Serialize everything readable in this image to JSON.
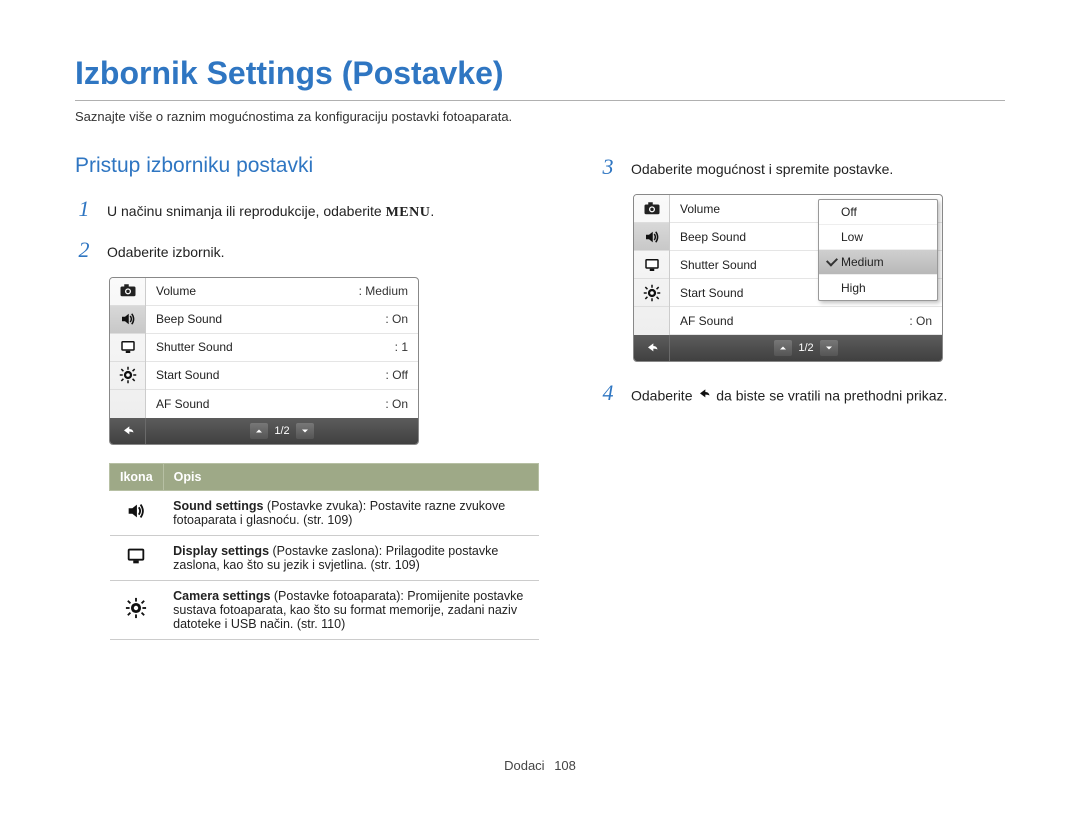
{
  "title": "Izbornik Settings (Postavke)",
  "subtitle": "Saznajte više o raznim mogućnostima za konfiguraciju postavki fotoaparata.",
  "sectionHeading": "Pristup izborniku postavki",
  "menuGlyph": "MENU",
  "steps": {
    "s1": {
      "num": "1",
      "text_a": "U načinu snimanja ili reprodukcije, odaberite ",
      "text_b": "."
    },
    "s2": {
      "num": "2",
      "text": "Odaberite izbornik."
    },
    "s3": {
      "num": "3",
      "text": "Odaberite mogućnost i spremite postavke."
    },
    "s4": {
      "num": "4",
      "text_a": "Odaberite ",
      "text_b": " da biste se vratili na prethodni prikaz."
    }
  },
  "lcd1": {
    "rows": [
      {
        "label": "Volume",
        "value": ": Medium"
      },
      {
        "label": "Beep Sound",
        "value": ": On"
      },
      {
        "label": "Shutter Sound",
        "value": ": 1"
      },
      {
        "label": "Start Sound",
        "value": ": Off"
      },
      {
        "label": "AF Sound",
        "value": ": On"
      }
    ],
    "pager": "1/2"
  },
  "lcd2": {
    "rows": [
      {
        "label": "Volume",
        "value": ""
      },
      {
        "label": "Beep Sound",
        "value": ""
      },
      {
        "label": "Shutter Sound",
        "value": ""
      },
      {
        "label": "Start Sound",
        "value": ""
      },
      {
        "label": "AF Sound",
        "value": ": On"
      }
    ],
    "options": [
      "Off",
      "Low",
      "Medium",
      "High"
    ],
    "selectedIndex": 2,
    "pager": "1/2"
  },
  "iconTable": {
    "head": {
      "icon": "Ikona",
      "desc": "Opis"
    },
    "rows": [
      {
        "icon": "sound",
        "strong": "Sound settings",
        "rest": " (Postavke zvuka): Postavite razne zvukove fotoaparata i glasnoću. (str. 109)"
      },
      {
        "icon": "display",
        "strong": "Display settings",
        "rest": " (Postavke zaslona): Prilagodite postavke zaslona, kao što su jezik i svjetlina. (str. 109)"
      },
      {
        "icon": "camera",
        "strong": "Camera settings",
        "rest": " (Postavke fotoaparata): Promijenite postavke sustava fotoaparata, kao što su format memorije, zadani naziv datoteke i USB način. (str. 110)"
      }
    ]
  },
  "footer": {
    "section": "Dodaci",
    "page": "108"
  }
}
